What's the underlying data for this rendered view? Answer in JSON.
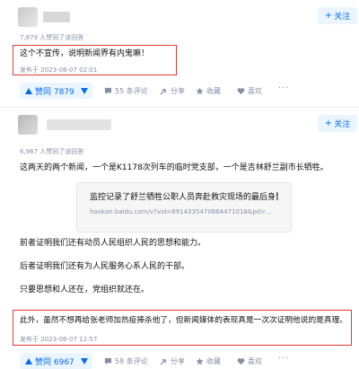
{
  "answer1": {
    "follow_label": "关注",
    "approval_count": "7,879 人赞同了该回答",
    "content": "这个不宣传，说明新闻界有内鬼嘛！",
    "published": "发布于 2023-08-07 02:01",
    "vote_label": "赞同 7879",
    "comments_label": "55 条评论",
    "share_label": "分享",
    "favorite_label": "收藏",
    "like_label": "喜欢"
  },
  "answer2": {
    "follow_label": "关注",
    "approval_count": "6,967 人赞同了该回答",
    "paragraphs": [
      "这两天的两个新闻，一个是K1178次列车的临时党支部，一个是吉林舒兰副市长牺牲。",
      "前者证明我们还有动员人民组织人民的思想和能力。",
      "后者证明我们还有为人民服务心系人民的干部。",
      "只要思想和人还在，党组织就还在。",
      "此外，虽然不想再给张老师加热疫捧杀他了，但新闻媒体的表现真是一次次证明他说的是真理。"
    ],
    "link_card": {
      "title": "监控记录了舒兰牺牲公职人员奔赴救灾现场的最后身影",
      "url": "haokan.baidu.com/v?vid=8914335470864471018&pd=..."
    },
    "published": "发布于 2023-08-07 12:57",
    "vote_label": "赞同 6967",
    "comments_label": "58 条评论",
    "share_label": "分享",
    "favorite_label": "收藏",
    "like_label": "喜欢"
  },
  "colors": {
    "accent": "#056de8",
    "accent_bg": "#ebf5ff",
    "meta": "#8590a6",
    "highlight_box": "#e53935"
  },
  "icons": [
    "plus-icon",
    "vote-up-icon",
    "vote-down-icon",
    "comment-icon",
    "share-icon",
    "star-icon",
    "heart-icon",
    "more-icon"
  ]
}
